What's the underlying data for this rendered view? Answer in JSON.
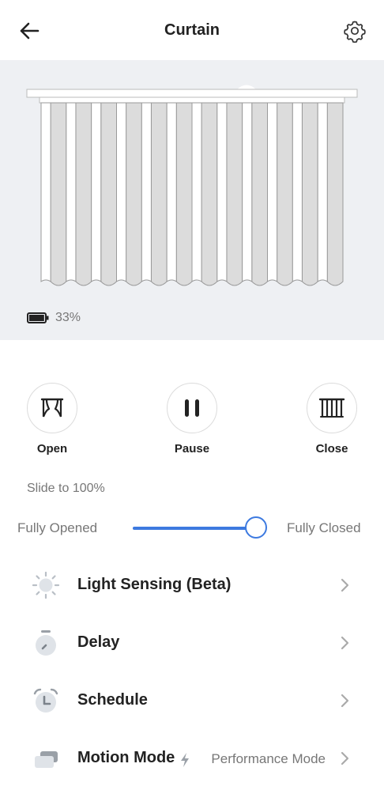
{
  "header": {
    "title": "Curtain",
    "back_icon": "arrow-left-icon",
    "settings_icon": "gear-icon"
  },
  "preview": {
    "battery_percent": "33%",
    "battery_level": 0.33
  },
  "controls": [
    {
      "label": "Open",
      "icon": "curtain-open-icon"
    },
    {
      "label": "Pause",
      "icon": "pause-icon"
    },
    {
      "label": "Close",
      "icon": "curtain-close-icon"
    }
  ],
  "slider": {
    "hint": "Slide to 100%",
    "left_label": "Fully Opened",
    "right_label": "Fully Closed",
    "value": 100
  },
  "menu": [
    {
      "label": "Light Sensing (Beta)",
      "icon": "sun-icon",
      "value": ""
    },
    {
      "label": "Delay",
      "icon": "timer-icon",
      "value": ""
    },
    {
      "label": "Schedule",
      "icon": "alarm-clock-icon",
      "value": ""
    },
    {
      "label": "Motion Mode",
      "icon": "motion-mode-icon",
      "value": "Performance Mode"
    }
  ],
  "colors": {
    "accent": "#3d7ae0",
    "preview_bg": "#eef0f3",
    "muted_text": "#777777"
  }
}
